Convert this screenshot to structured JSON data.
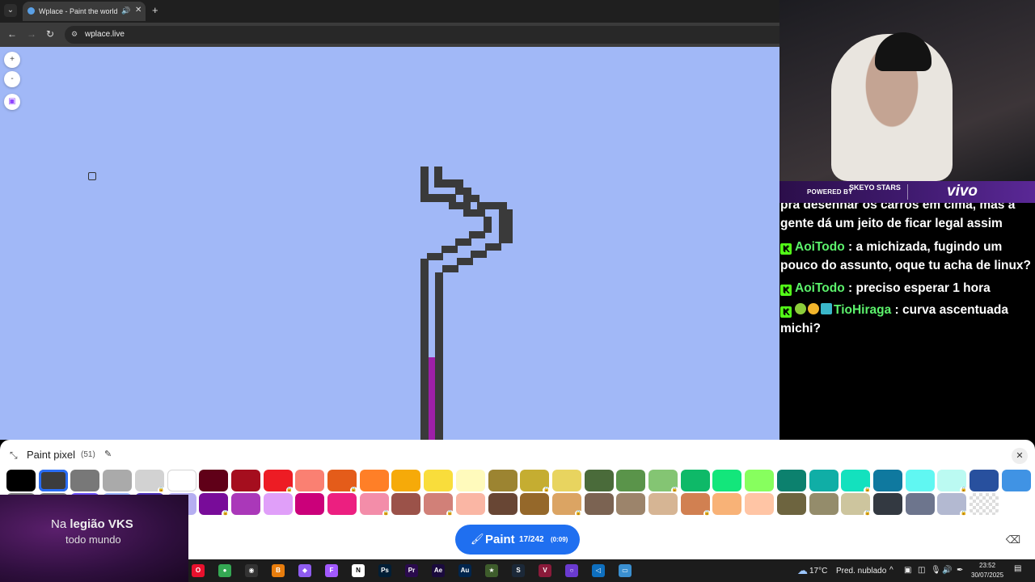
{
  "browser": {
    "tab_title": "Wplace - Paint the world",
    "tab_menu_icon": "chevron-down-icon",
    "audio_icon": "speaker-icon",
    "close_label": "✕",
    "new_tab_label": "+",
    "url": "wplace.live"
  },
  "map_controls": {
    "zoom_in": "+",
    "zoom_out": "-"
  },
  "stream": {
    "sponsor_powered": "POWERED BY",
    "sponsor_brand": "SKEYO STARS",
    "sponsor_vivo": "vivo",
    "overlay_line1_prefix": "Na ",
    "overlay_line1_bold": "legião VKS",
    "overlay_line2": "todo mundo"
  },
  "chat": {
    "messages": [
      {
        "user": "",
        "text": "pra desenhar os carros em cima, mas a gente dá um jeito de ficar legal assim"
      },
      {
        "user": "AoiTodo",
        "text": " : a michizada, fugindo um pouco do assunto, oque tu acha de linux?"
      },
      {
        "user": "AoiTodo",
        "text": " : preciso esperar 1 hora"
      },
      {
        "user": "TioHiraga",
        "text": " : curva ascentuada michi?"
      }
    ]
  },
  "paint_panel": {
    "title": "Paint pixel",
    "count": "(51)",
    "close_label": "✕",
    "paint_label": "Paint",
    "paint_count": "17/242",
    "paint_timer": "(0:09)",
    "palette_row1": [
      "#000000",
      "#3c3c3c",
      "#787878",
      "#aaaaaa",
      "#d2d2d2",
      "#ffffff",
      "#600018",
      "#a50e1e",
      "#ed1c24",
      "#fa8072",
      "#e45c1a",
      "#ff7f27",
      "#f6aa09",
      "#f9dd3b",
      "#fffabc",
      "#9c8431",
      "#c5ad31",
      "#e8d45f",
      "#4a6b3a",
      "#5a944a",
      "#84c573",
      "#0eb968",
      "#13e67b",
      "#87ff5e",
      "#0c816e",
      "#10aea6",
      "#13e1be",
      "#0f799f",
      "#60f7f2",
      "#bbfaf2",
      "#28509e",
      "#4093e4"
    ],
    "palette_row2": [
      "#7d7d7d",
      "#7d7d7d",
      "#6b50f6",
      "#99b1fb",
      "#4d31b8",
      "#b5aef1",
      "#780c99",
      "#aa38b9",
      "#e09ff9",
      "#cb007a",
      "#ec1f80",
      "#f38da9",
      "#9b5249",
      "#d18078",
      "#fab6a4",
      "#684634",
      "#95682a",
      "#dba463",
      "#7b6352",
      "#9c846b",
      "#d6b594",
      "#d18051",
      "#f8b277",
      "#ffc5a5",
      "#6d643f",
      "#948c6b",
      "#cdc59e",
      "#333941",
      "#6d758d",
      "#b3b9d1",
      "#trans"
    ],
    "row1_locked": [
      false,
      false,
      false,
      false,
      true,
      false,
      false,
      false,
      true,
      false,
      true,
      false,
      false,
      false,
      false,
      false,
      true,
      false,
      false,
      false,
      true,
      false,
      false,
      false,
      false,
      false,
      true,
      false,
      false,
      true,
      false,
      false
    ],
    "row2_locked": [
      false,
      false,
      false,
      false,
      false,
      false,
      true,
      false,
      false,
      false,
      false,
      true,
      false,
      true,
      false,
      false,
      false,
      true,
      false,
      false,
      false,
      true,
      false,
      false,
      false,
      false,
      true,
      false,
      false,
      true,
      false,
      false
    ],
    "selected_index": 1
  },
  "taskbar": {
    "weather_temp": "17°C",
    "weather_desc": "Pred. nublado",
    "time": "23:52",
    "date": "30/07/2025",
    "apps": [
      {
        "name": "opera",
        "label": "O",
        "color": "#e8112d"
      },
      {
        "name": "chrome",
        "label": "●",
        "color": "#34a853"
      },
      {
        "name": "obs",
        "label": "◉",
        "color": "#333333"
      },
      {
        "name": "blender",
        "label": "B",
        "color": "#e87d0d"
      },
      {
        "name": "crystal",
        "label": "◆",
        "color": "#8f5cf0"
      },
      {
        "name": "figma",
        "label": "F",
        "color": "#a259ff"
      },
      {
        "name": "notion",
        "label": "N",
        "color": "#ffffff"
      },
      {
        "name": "photoshop",
        "label": "Ps",
        "color": "#001e36"
      },
      {
        "name": "premiere",
        "label": "Pr",
        "color": "#2a0a4d"
      },
      {
        "name": "aftereffects",
        "label": "Ae",
        "color": "#1a0a3d"
      },
      {
        "name": "audition",
        "label": "Au",
        "color": "#00254d"
      },
      {
        "name": "game",
        "label": "★",
        "color": "#3e5c2c"
      },
      {
        "name": "steam",
        "label": "S",
        "color": "#1b2838"
      },
      {
        "name": "v-app",
        "label": "V",
        "color": "#8a1a3a"
      },
      {
        "name": "circle",
        "label": "○",
        "color": "#6a3ad0"
      },
      {
        "name": "vscode",
        "label": "◁",
        "color": "#0e6fbf"
      },
      {
        "name": "files",
        "label": "▭",
        "color": "#3a8fd0"
      }
    ]
  }
}
